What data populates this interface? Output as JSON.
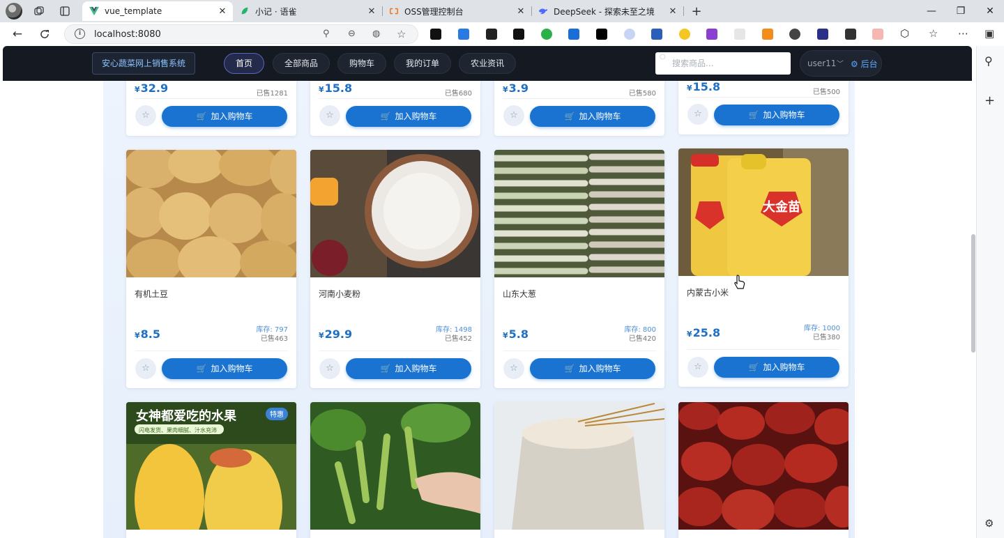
{
  "browser": {
    "tabs": [
      {
        "title": "vue_template",
        "icon": "vue-icon",
        "active": true
      },
      {
        "title": "小记 · 语雀",
        "icon": "yuque-icon",
        "active": false
      },
      {
        "title": "OSS管理控制台",
        "icon": "aliyun-icon",
        "active": false
      },
      {
        "title": "DeepSeek - 探索未至之境",
        "icon": "deepseek-icon",
        "active": false
      }
    ],
    "new_tab": "+",
    "minimize": "—",
    "restore": "❐",
    "close": "✕",
    "url": "localhost:8080"
  },
  "app": {
    "brand": "安心蔬菜网上销售系统",
    "nav": [
      "首页",
      "全部商品",
      "购物车",
      "我的订单",
      "农业资讯"
    ],
    "active_nav": "首页",
    "search_placeholder": "搜索商品...",
    "user": "user11",
    "admin_label": "后台"
  },
  "cart_label": "加入购物车",
  "currency": "¥",
  "products_top": [
    {
      "price": "32.9",
      "sold": "已售1281"
    },
    {
      "price": "15.8",
      "sold": "已售680"
    },
    {
      "price": "3.9",
      "sold": "已售580"
    },
    {
      "price": "15.8",
      "sold": "已售500"
    }
  ],
  "products_mid": [
    {
      "name": "有机土豆",
      "price": "8.5",
      "stock": "库存: 797",
      "sold": "已售463"
    },
    {
      "name": "河南小麦粉",
      "price": "29.9",
      "stock": "库存: 1498",
      "sold": "已售452"
    },
    {
      "name": "山东大葱",
      "price": "5.8",
      "stock": "库存: 800",
      "sold": "已售420"
    },
    {
      "name": "内蒙古小米",
      "price": "25.8",
      "stock": "库存: 1000",
      "sold": "已售380"
    }
  ],
  "products_bottom_banner": {
    "headline": "女神都爱吃的水果",
    "subline": "闪电发货、果肉细腻、汁水充沛",
    "badge": "特惠"
  },
  "product_image_text": {
    "rice_bag": "大金苗"
  },
  "colors": {
    "header_bg": "#151a22",
    "accent": "#1a73d1",
    "price": "#1f6fc5",
    "stock": "#4d8fd6"
  }
}
